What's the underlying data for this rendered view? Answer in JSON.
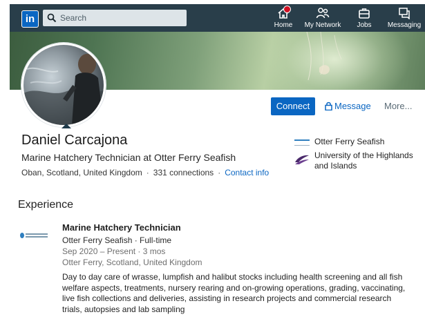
{
  "nav": {
    "logo_text": "in",
    "search_placeholder": "Search",
    "items": [
      {
        "label": "Home",
        "icon": "home-icon",
        "has_notification": true
      },
      {
        "label": "My Network",
        "icon": "network-icon"
      },
      {
        "label": "Jobs",
        "icon": "briefcase-icon"
      },
      {
        "label": "Messaging",
        "icon": "messaging-icon"
      }
    ],
    "accent_color": "#0a66c2",
    "bar_color": "#293e4a"
  },
  "profile": {
    "name": "Daniel Carcajona",
    "headline": "Marine Hatchery Technician at Otter Ferry Seafish",
    "location": "Oban, Scotland, United Kingdom",
    "connections": "331 connections",
    "contact_info": "Contact info",
    "separator": "·",
    "actions": {
      "connect": "Connect",
      "message": "Message",
      "more": "More..."
    },
    "organizations": [
      {
        "name": "Otter Ferry Seafish",
        "logo": "otter-ferry-logo"
      },
      {
        "name": "University of the Highlands and Islands",
        "logo": "uhi-logo"
      }
    ]
  },
  "experience": {
    "title": "Experience",
    "items": [
      {
        "role": "Marine Hatchery Technician",
        "company": "Otter Ferry Seafish · Full-time",
        "dates": "Sep 2020 – Present · 3 mos",
        "location": "Otter Ferry, Scotland, United Kingdom",
        "description": "Day to day care of wrasse, lumpfish and halibut stocks including health screening and all fish welfare aspects, treatments, nursery rearing and on-growing operations, grading, vaccinating, live fish collections and deliveries, assisting in research projects and commercial research trials, autopsies and lab sampling"
      }
    ]
  }
}
